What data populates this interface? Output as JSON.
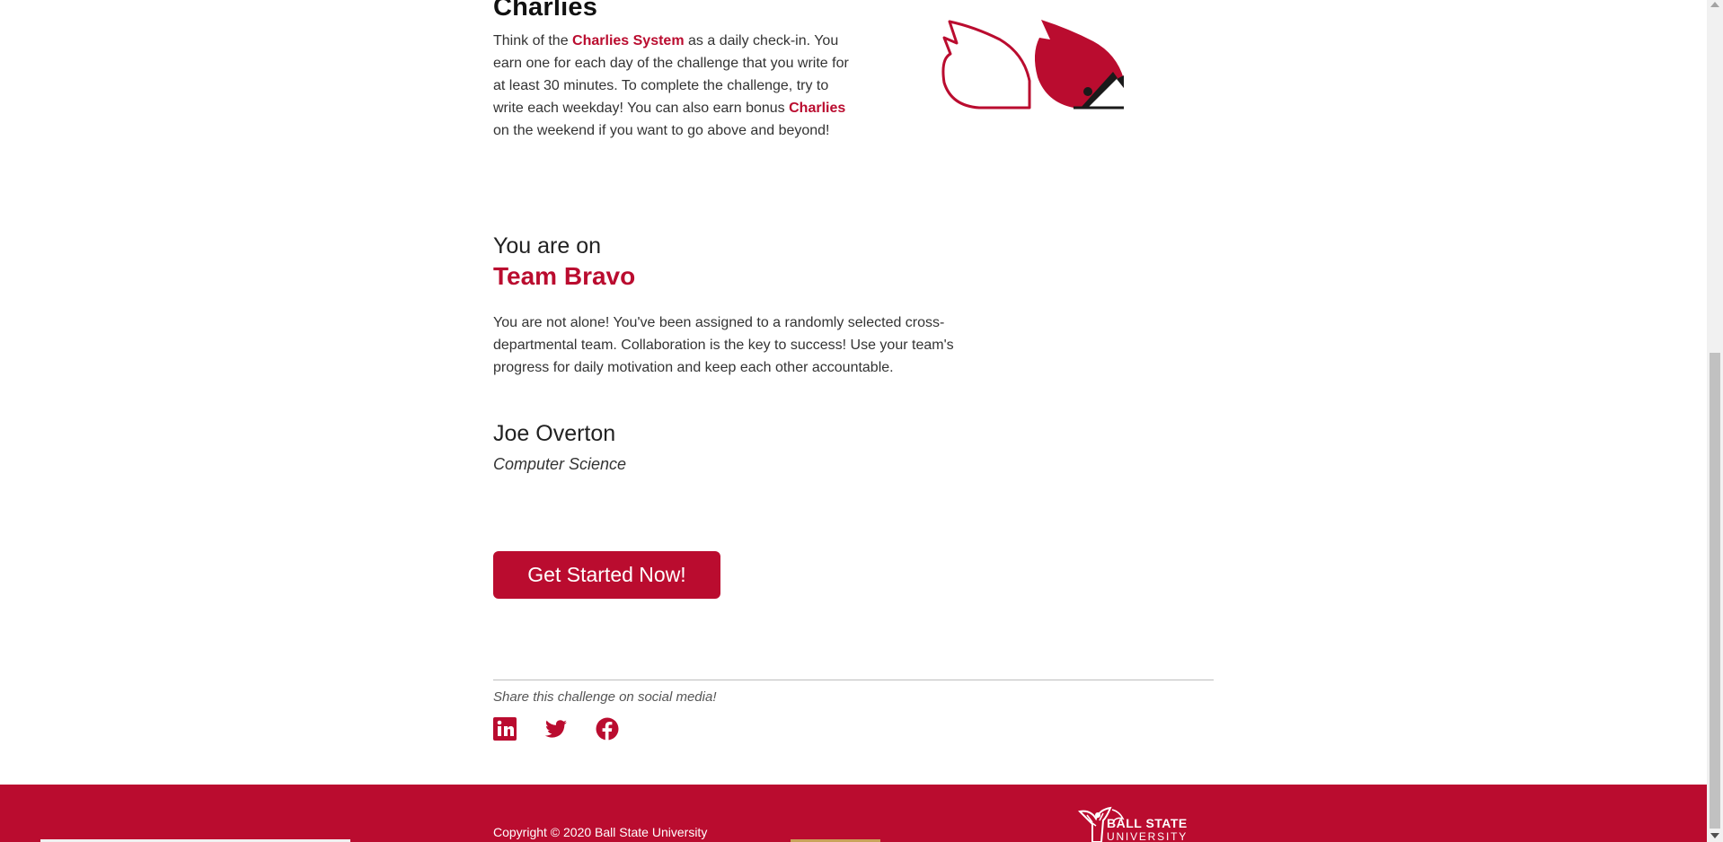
{
  "charlies": {
    "heading": "Charlies",
    "text_1": "Think of the ",
    "bold_1": "Charlies System",
    "text_2": " as a daily check-in. You earn one for each day of the challenge that you write for at least 30 minutes. To complete the challenge, try to write each weekday! You can also earn bonus ",
    "bold_2": "Charlies",
    "text_3": " on the weekend if you want to go above and beyond!",
    "icons": [
      "empty-cardinal-icon",
      "filled-cardinal-icon"
    ]
  },
  "team": {
    "pre": "You are on",
    "name": "Team Bravo",
    "description": "You are not alone! You've been assigned to a randomly selected cross-departmental team. Collaboration is the key to success! Use your team's progress for daily motivation and keep each other accountable."
  },
  "member": {
    "name": "Joe Overton",
    "department": "Computer Science"
  },
  "cta": {
    "label": "Get Started Now!"
  },
  "share": {
    "text": "Share this challenge on social media!",
    "icons": [
      "linkedin-icon",
      "twitter-icon",
      "facebook-icon"
    ]
  },
  "footer": {
    "copyright": "Copyright © 2020 Ball State University",
    "logo_title": "BALL STATE",
    "logo_sub": "UNIVERSITY"
  },
  "colors": {
    "brand": "#ba0c2f",
    "text": "#333333",
    "footer_bg": "#ba0c2f"
  }
}
